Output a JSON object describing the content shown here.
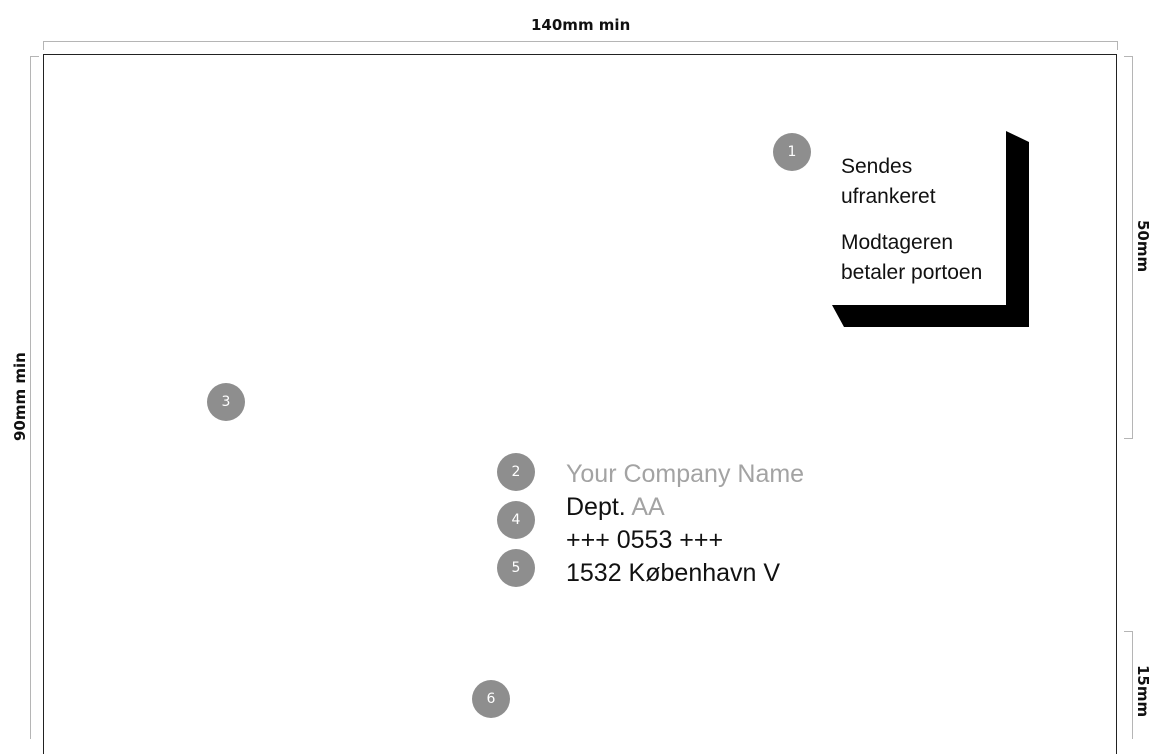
{
  "dimensions": {
    "width_label": "140mm min",
    "height_label": "90mm min",
    "top_right_label": "50mm",
    "bottom_right_label": "15mm"
  },
  "markers": [
    "1",
    "2",
    "3",
    "4",
    "5",
    "6"
  ],
  "postage_box": {
    "line1": "Sendes",
    "line2": "ufrankeret",
    "line3": "Modtageren",
    "line4": "betaler portoen"
  },
  "address": {
    "company": "Your Company Name",
    "dept_prefix": "Dept.",
    "dept_code": "AA",
    "box_number": "+++ 0553 +++",
    "city_line": "1532 København V"
  },
  "colors": {
    "marker_fill": "#8e8e8e",
    "muted_text": "#a3a3a3",
    "frame_black": "#000000",
    "guide_line": "#b5b5b5"
  }
}
